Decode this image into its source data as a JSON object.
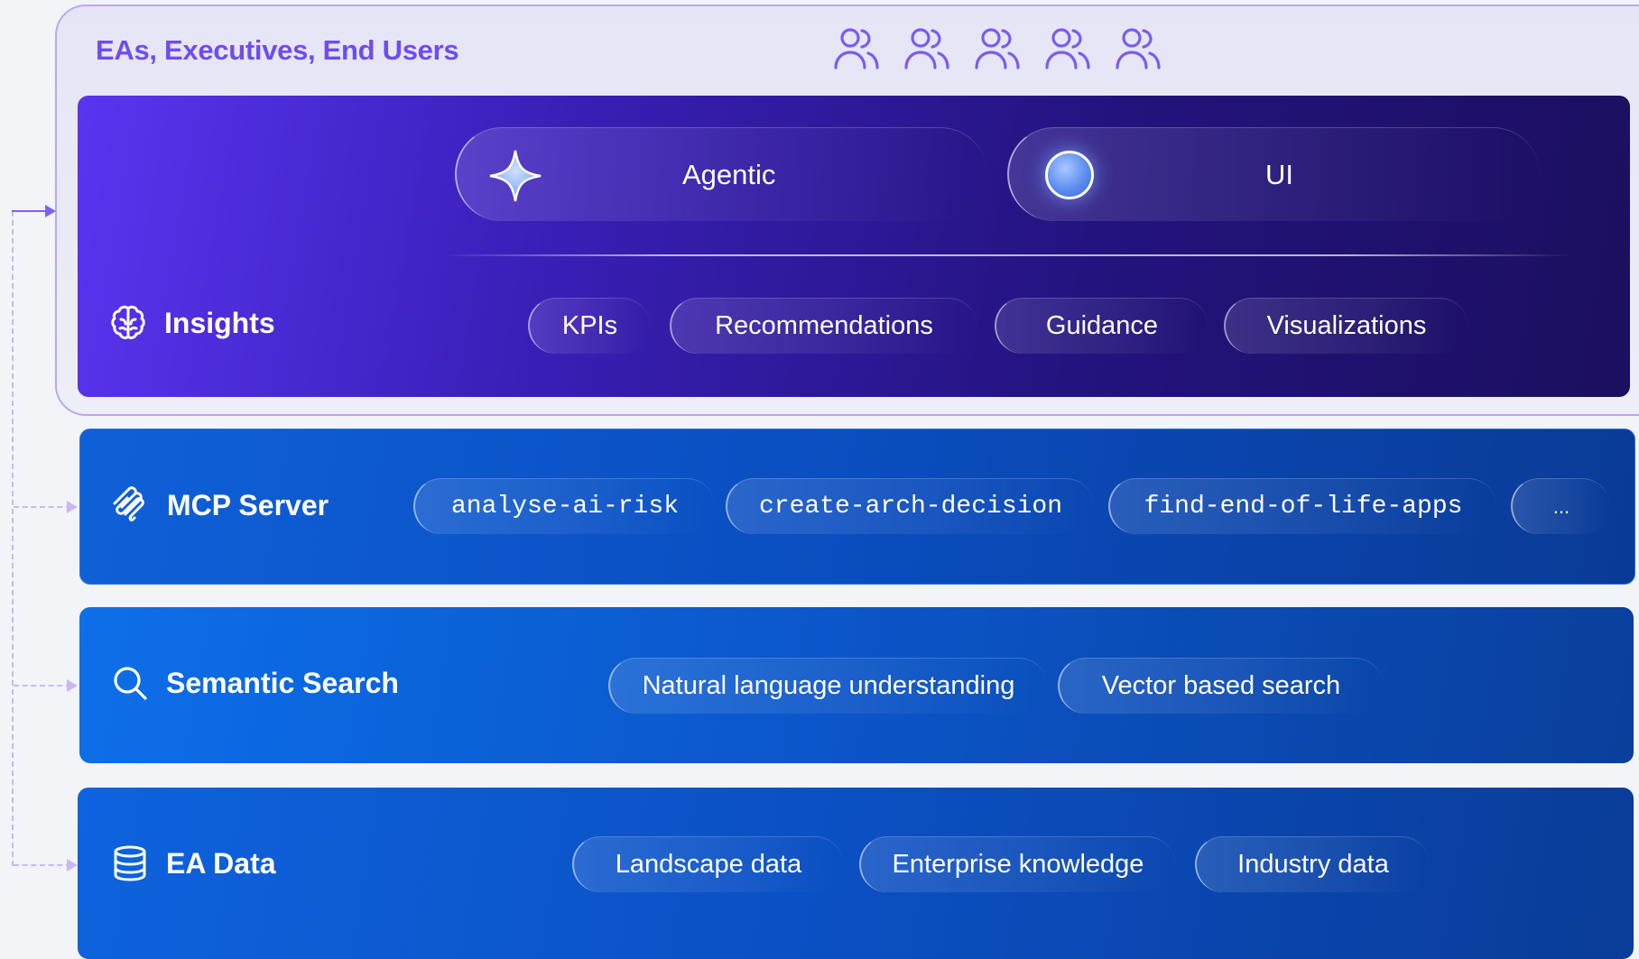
{
  "users": {
    "title": "EAs, Executives, End Users",
    "icon_count": 5,
    "icon": "users-icon"
  },
  "insights": {
    "label": "Insights",
    "icon": "brain-icon",
    "modes": [
      {
        "label": "Agentic",
        "icon": "sparkle-icon"
      },
      {
        "label": "UI",
        "icon": "orb-icon"
      }
    ],
    "pills": [
      "KPIs",
      "Recommendations",
      "Guidance",
      "Visualizations"
    ]
  },
  "mcp": {
    "label": "MCP Server",
    "icon": "mcp-icon",
    "pills": [
      "analyse-ai-risk",
      "create-arch-decision",
      "find-end-of-life-apps",
      "..."
    ]
  },
  "search": {
    "label": "Semantic Search",
    "icon": "search-icon",
    "pills": [
      "Natural language understanding",
      "Vector based search"
    ]
  },
  "data": {
    "label": "EA Data",
    "icon": "database-icon",
    "pills": [
      "Landscape data",
      "Enterprise knowledge",
      "Industry data"
    ]
  },
  "colors": {
    "accent_purple": "#6e4df0",
    "insights_bg": "#3a1fb8",
    "layer_blue": "#0b55c8"
  }
}
